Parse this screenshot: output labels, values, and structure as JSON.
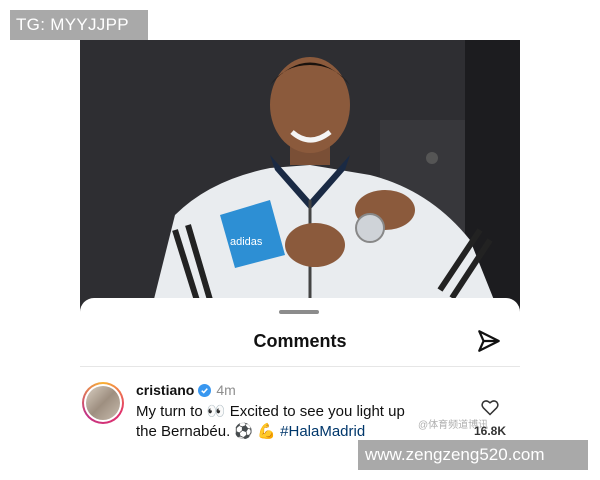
{
  "watermark_top": "TG: MYYJJPP",
  "watermark_bottom": "www.zengzeng520.com",
  "photo": {
    "description_icon": "photo-of-boy-in-tracksuit"
  },
  "sheet": {
    "title": "Comments",
    "send_icon": "send-icon"
  },
  "comment": {
    "username": "cristiano",
    "verified": true,
    "time": "4m",
    "text_part1": "My turn to ",
    "eyes_emoji": "👀",
    "text_part2": " Excited to see you light up the Bernabéu. ",
    "ball_emoji": "⚽",
    "arm_emoji": "💪",
    "hashtag": "#HalaMadrid",
    "likes": "16.8K",
    "faint_mark": "@体育频道博讯"
  },
  "colors": {
    "verified_blue": "#3897f0",
    "hashtag": "#00376b"
  }
}
